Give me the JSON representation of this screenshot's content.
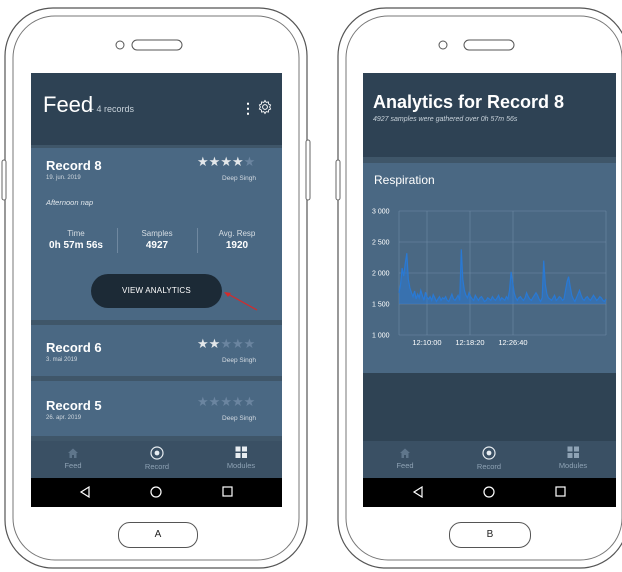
{
  "colors": {
    "header": "#2e4254",
    "card": "#4a6883",
    "screen_bg": "#3f5669",
    "button_dark": "#1c2a36",
    "plot_line": "#2979d4",
    "annotation_arrow": "#d62a2a"
  },
  "phone_a": {
    "label": "A",
    "header": {
      "title": "Feed",
      "subtitle": "- 4 records",
      "menu_icon": "kebab-menu-icon",
      "settings_icon": "gear-icon"
    },
    "records": [
      {
        "title": "Record 8",
        "date": "19. jun. 2019",
        "rating": 4,
        "author": "Deep Singh",
        "note": "Afternoon nap",
        "stats": [
          {
            "label": "Time",
            "value": "0h 57m 56s"
          },
          {
            "label": "Samples",
            "value": "4927"
          },
          {
            "label": "Avg. Resp",
            "value": "1920"
          }
        ],
        "share_icon": "share-icon",
        "action_label": "VIEW ANALYTICS",
        "delete_icon": "trash-icon"
      },
      {
        "title": "Record 6",
        "date": "3. mai 2019",
        "rating": 2,
        "author": "Deep Singh"
      },
      {
        "title": "Record 5",
        "date": "26. apr. 2019",
        "rating": 0,
        "author": "Deep Singh"
      }
    ],
    "bottom_nav": [
      {
        "label": "Feed",
        "icon": "home-icon"
      },
      {
        "label": "Record",
        "icon": "record-icon"
      },
      {
        "label": "Modules",
        "icon": "modules-icon"
      }
    ]
  },
  "phone_b": {
    "label": "B",
    "header": {
      "title": "Analytics for Record 8",
      "subtitle": "4927 samples were gathered over 0h 57m 56s"
    },
    "panel_title": "Respiration",
    "bottom_nav": [
      {
        "label": "Feed",
        "icon": "home-icon"
      },
      {
        "label": "Record",
        "icon": "record-icon"
      },
      {
        "label": "Modules",
        "icon": "modules-icon"
      }
    ]
  },
  "chart_data": {
    "type": "line",
    "title": "Respiration",
    "ytick_labels": [
      "3 000",
      "2 500",
      "2 000",
      "1 500",
      "1 000"
    ],
    "yticks": [
      3000,
      2500,
      2000,
      1500,
      1000
    ],
    "ylim": [
      1000,
      3000
    ],
    "xtick_labels": [
      "12:10:00",
      "12:18:20",
      "12:26:40"
    ],
    "grid": true,
    "series": [
      {
        "values": [
          1680,
          1820,
          2080,
          1950,
          2150,
          2320,
          1900,
          1760,
          1680,
          1620,
          1710,
          1580,
          1660,
          1600,
          1720,
          1640,
          1560,
          1690,
          1610,
          1580,
          1620,
          1560,
          1650,
          1600,
          1540,
          1580,
          1620,
          1560,
          1600,
          1580,
          1620,
          1560,
          1540,
          1600,
          1660,
          1580,
          1560,
          1600,
          1640,
          1560,
          2380,
          1900,
          1720,
          1640,
          1600,
          1680,
          1620,
          1580,
          1560,
          1640,
          1600,
          1560,
          1600,
          1620,
          1580,
          1540,
          1560,
          1600,
          1580,
          1560,
          1620,
          1580,
          1560,
          1600,
          1640,
          1560,
          1600,
          1580,
          1560,
          1620,
          1580,
          1720,
          2020,
          1860,
          1680,
          1600,
          1560,
          1600,
          1620,
          1580,
          1560,
          1600,
          1680,
          1620,
          1580,
          1560,
          1600,
          1640,
          1680,
          1640,
          1580,
          1540,
          1600,
          2200,
          1820,
          1660,
          1600,
          1580,
          1560,
          1600,
          1640,
          1560,
          1580,
          1620,
          1600,
          1560,
          1580,
          1720,
          1860,
          1940,
          1780,
          1640,
          1580,
          1540,
          1600,
          1660,
          1720,
          1640,
          1580,
          1560,
          1600,
          1620,
          1580,
          1560,
          1600,
          1640,
          1600,
          1560,
          1580,
          1620,
          1600,
          1560,
          1540,
          1580
        ]
      }
    ]
  }
}
